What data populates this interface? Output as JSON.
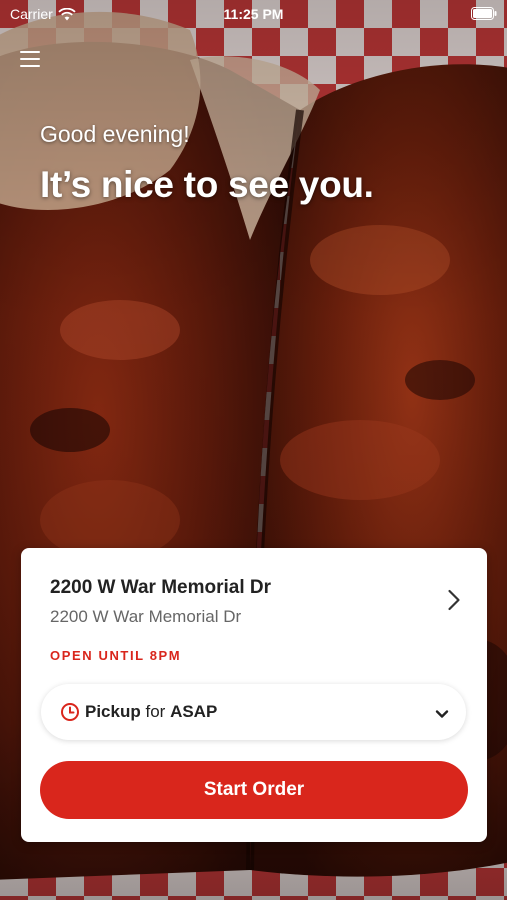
{
  "status_bar": {
    "carrier": "Carrier",
    "time": "11:25 PM",
    "wifi_icon": "wifi-icon",
    "battery_icon": "battery-full-icon"
  },
  "header": {
    "menu_icon": "hamburger-menu-icon"
  },
  "hero": {
    "greeting": "Good evening!",
    "headline": "It’s nice to see you.",
    "background_image": "bbq-ribs-on-checkered-tablecloth"
  },
  "location": {
    "name": "2200 W War Memorial Dr",
    "address": "2200 W War Memorial Dr",
    "hours": "OPEN UNTIL 8PM"
  },
  "order_options": {
    "mode": "Pickup",
    "connector": "for",
    "time": "ASAP"
  },
  "actions": {
    "start_order_label": "Start Order"
  },
  "colors": {
    "accent_red": "#d9261c",
    "card_background": "#ffffff",
    "title_text": "#222222",
    "secondary_text": "#666666"
  }
}
